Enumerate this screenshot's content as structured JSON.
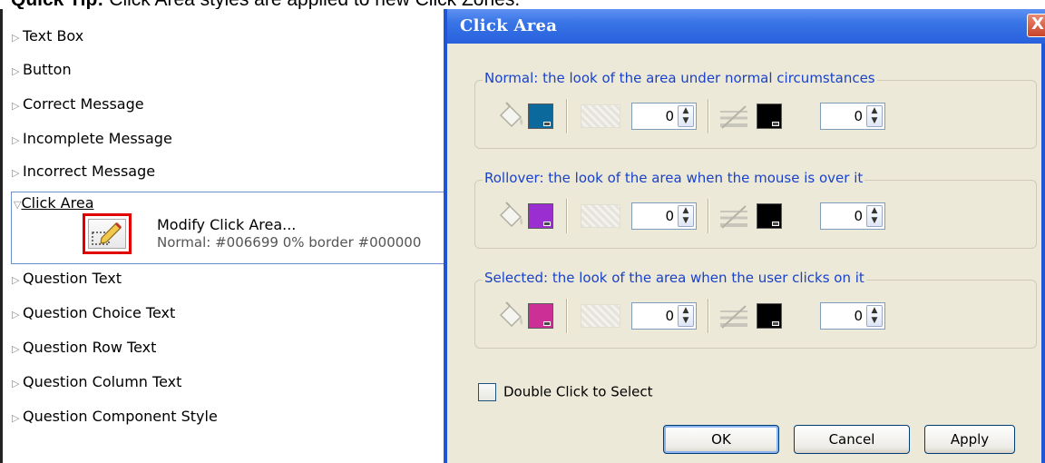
{
  "caption": {
    "bold": "Quick Tip:",
    "text": "Click Area styles are applied to new Click Zones."
  },
  "tree": {
    "items_before": [
      {
        "label": "Text Box"
      },
      {
        "label": "Button"
      },
      {
        "label": "Correct Message"
      },
      {
        "label": "Incomplete Message"
      },
      {
        "label": "Incorrect Message"
      }
    ],
    "expanded": {
      "label": "Click Area",
      "action_title": "Modify Click Area...",
      "action_desc": "Normal: #006699 0% border #000000"
    },
    "items_after": [
      {
        "label": "Question Text"
      },
      {
        "label": "Question Choice Text"
      },
      {
        "label": "Question Row Text"
      },
      {
        "label": "Question Column Text"
      },
      {
        "label": "Question Component Style"
      }
    ]
  },
  "dialog": {
    "title": "Click Area",
    "close": "X",
    "groups": [
      {
        "legend": "Normal: the look of the area under normal circumstances",
        "fill_color": "#0b6a9b",
        "opacity": "0",
        "border_color": "#000000",
        "border_width": "0"
      },
      {
        "legend": "Rollover: the look of the area when the mouse is over it",
        "fill_color": "#9a2ed0",
        "opacity": "0",
        "border_color": "#000000",
        "border_width": "0"
      },
      {
        "legend": "Selected: the look of the area when the user clicks on it",
        "fill_color": "#cc2f96",
        "opacity": "0",
        "border_color": "#000000",
        "border_width": "0"
      }
    ],
    "double_click_label": "Double Click to Select",
    "double_click_checked": false,
    "buttons": {
      "ok": "OK",
      "cancel": "Cancel",
      "apply": "Apply"
    }
  },
  "colors": {
    "accent": "#1e56d6",
    "dialog_bg": "#ece9d8",
    "legend": "#1a42c8",
    "highlight": "#e00000"
  }
}
